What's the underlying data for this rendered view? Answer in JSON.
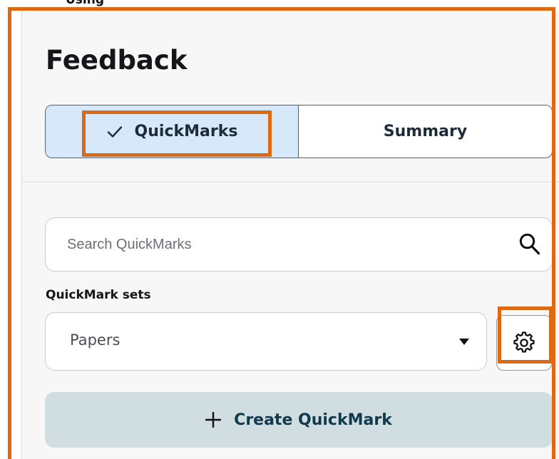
{
  "caption": {
    "text": "Using"
  },
  "panel": {
    "title": "Feedback",
    "tabs": {
      "quickmarks_label": "QuickMarks",
      "summary_label": "Summary"
    },
    "search": {
      "placeholder": "Search QuickMarks",
      "value": ""
    },
    "sets": {
      "label": "QuickMark sets",
      "selected": "Papers"
    },
    "create_button_label": "Create QuickMark",
    "icons": {
      "check": "check-icon",
      "search": "search-icon",
      "dropdown": "chevron-down-icon",
      "gear": "gear-icon",
      "plus": "plus-icon"
    },
    "colors": {
      "highlight": "#dd6a12",
      "active_tab": "#d6e8f9",
      "create_button": "#d0dee2",
      "text": "#15151a"
    }
  }
}
